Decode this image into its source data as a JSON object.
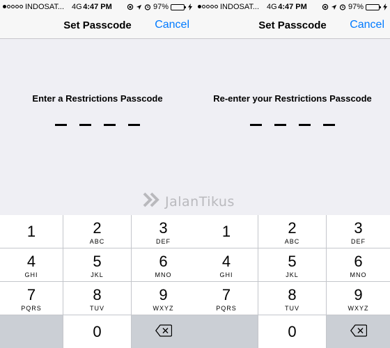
{
  "status_bar": {
    "carrier": "INDOSAT...",
    "network": "4G",
    "time": "4:47 PM",
    "battery": "97%"
  },
  "nav": {
    "title": "Set Passcode",
    "cancel": "Cancel"
  },
  "screens": [
    {
      "prompt": "Enter a Restrictions Passcode"
    },
    {
      "prompt": "Re-enter your Restrictions Passcode"
    }
  ],
  "keypad": {
    "keys": [
      {
        "num": "1",
        "letters": ""
      },
      {
        "num": "2",
        "letters": "ABC"
      },
      {
        "num": "3",
        "letters": "DEF"
      },
      {
        "num": "4",
        "letters": "GHI"
      },
      {
        "num": "5",
        "letters": "JKL"
      },
      {
        "num": "6",
        "letters": "MNO"
      },
      {
        "num": "7",
        "letters": "PQRS"
      },
      {
        "num": "8",
        "letters": "TUV"
      },
      {
        "num": "9",
        "letters": "WXYZ"
      },
      {
        "num": "0",
        "letters": ""
      }
    ]
  },
  "watermark": {
    "text": "JalanTikus"
  },
  "colors": {
    "accent": "#007aff",
    "battery": "#4cd964",
    "background": "#efeff4"
  },
  "icons": [
    "location-icon",
    "alarm-icon",
    "orientation-lock-icon",
    "charging-bolt-icon",
    "delete-backspace-icon"
  ]
}
